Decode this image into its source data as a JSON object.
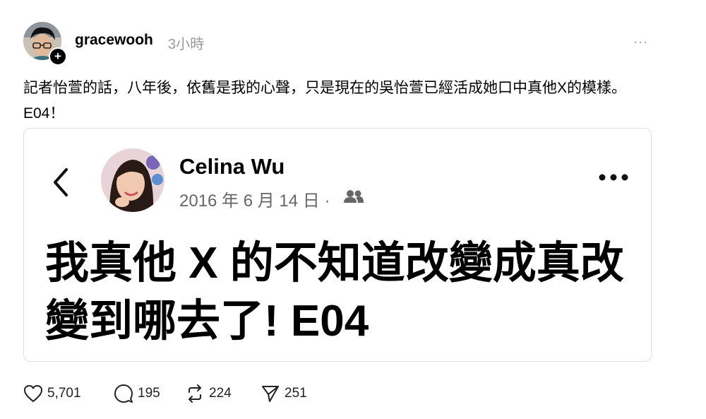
{
  "post": {
    "username": "gracewooh",
    "time_ago": "3小時",
    "more_label": "···",
    "follow_label": "+",
    "text": "記者怡萱的話，八年後，依舊是我的心聲，只是現在的吳怡萱已經活成她口中真他X的模樣。E04！"
  },
  "embedded": {
    "name": "Celina Wu",
    "date": "2016 年 6 月 14 日 ·",
    "privacy_icon": "friends-icon",
    "text": "我真他 X 的不知道改變成真改變到哪去了! E04"
  },
  "actions": {
    "likes": "5,701",
    "comments": "195",
    "reposts": "224",
    "shares": "251"
  },
  "colors": {
    "text": "#000000",
    "muted": "#999999",
    "border": "#dedede"
  }
}
